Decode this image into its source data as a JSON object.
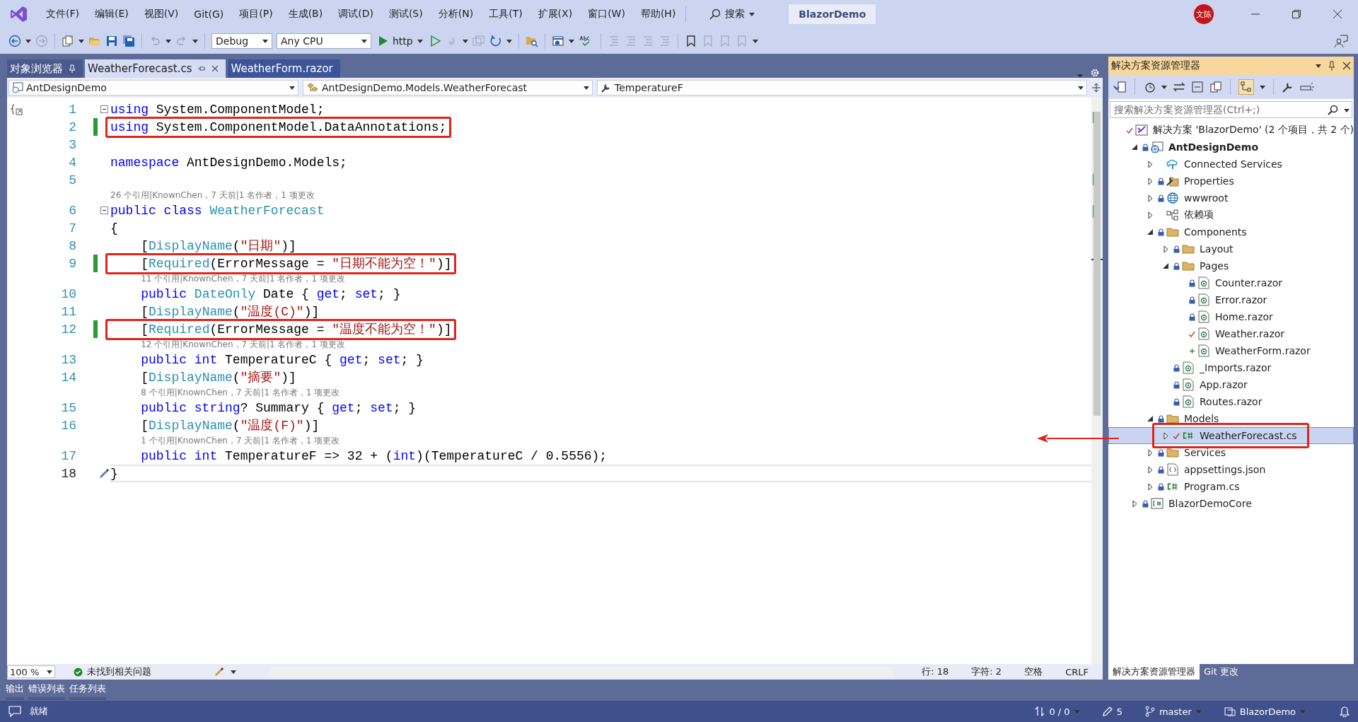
{
  "menu": {
    "items": [
      "文件(F)",
      "编辑(E)",
      "视图(V)",
      "Git(G)",
      "项目(P)",
      "生成(B)",
      "调试(D)",
      "测试(S)",
      "分析(N)",
      "工具(T)",
      "扩展(X)",
      "窗口(W)",
      "帮助(H)"
    ],
    "search": "搜索",
    "title": "BlazorDemo",
    "avatar": "文陈"
  },
  "toolbar": {
    "configuration": "Debug",
    "platform": "Any CPU",
    "run_target": "http"
  },
  "doc_tabs": [
    {
      "label": "对象浏览器",
      "selected": false,
      "pinned": true
    },
    {
      "label": "WeatherForecast.cs",
      "selected": true,
      "pinned": false
    },
    {
      "label": "WeatherForm.razor",
      "selected": false,
      "pinned": false
    }
  ],
  "nav_bar": {
    "project": "AntDesignDemo",
    "type": "AntDesignDemo.Models.WeatherForecast",
    "member": "TemperatureF"
  },
  "editor": {
    "lines": [
      {
        "kind": "code",
        "number": "1",
        "changed": false,
        "boxed": false,
        "fold": true,
        "current": false,
        "tokens": [
          {
            "kind": "keyword",
            "text": "using"
          },
          {
            "kind": "plain",
            "text": " System.ComponentModel;"
          }
        ]
      },
      {
        "kind": "code",
        "number": "2",
        "changed": true,
        "boxed": true,
        "fold": false,
        "current": false,
        "tokens": [
          {
            "kind": "keyword",
            "text": "using"
          },
          {
            "kind": "plain",
            "text": " System.ComponentModel.DataAnnotations;"
          }
        ]
      },
      {
        "kind": "code",
        "number": "3",
        "changed": false,
        "fold": false,
        "current": false
      },
      {
        "kind": "code",
        "number": "4",
        "changed": false,
        "boxed": false,
        "fold": false,
        "current": false,
        "tokens": [
          {
            "kind": "keyword",
            "text": "namespace"
          },
          {
            "kind": "plain",
            "text": " AntDesignDemo.Models;"
          }
        ]
      },
      {
        "kind": "code",
        "number": "5",
        "changed": false,
        "fold": false,
        "current": false
      },
      {
        "kind": "codelens",
        "text": "26 个引用|KnownChen，7 天前|1 名作者，1 项更改"
      },
      {
        "kind": "code",
        "number": "6",
        "changed": false,
        "boxed": false,
        "fold": true,
        "current": false,
        "tokens": [
          {
            "kind": "keyword",
            "text": "public class"
          },
          {
            "kind": "type",
            "text": " WeatherForecast"
          }
        ]
      },
      {
        "kind": "code",
        "number": "7",
        "changed": false,
        "boxed": false,
        "fold": false,
        "current": false,
        "tokens": [
          {
            "kind": "plain",
            "text": "{"
          }
        ]
      },
      {
        "kind": "code",
        "number": "8",
        "changed": false,
        "boxed": false,
        "fold": false,
        "current": false,
        "tokens": [
          {
            "kind": "plain",
            "text": "    ["
          },
          {
            "kind": "type",
            "text": "DisplayName"
          },
          {
            "kind": "plain",
            "text": "("
          },
          {
            "kind": "string",
            "text": "\"日期\""
          },
          {
            "kind": "plain",
            "text": ")]"
          }
        ]
      },
      {
        "kind": "code",
        "number": "9",
        "changed": true,
        "boxed": true,
        "fold": false,
        "current": false,
        "tokens": [
          {
            "kind": "plain",
            "text": "    ["
          },
          {
            "kind": "type",
            "text": "Required"
          },
          {
            "kind": "plain",
            "text": "(ErrorMessage = "
          },
          {
            "kind": "string",
            "text": "\"日期不能为空！\""
          },
          {
            "kind": "plain",
            "text": ")]"
          }
        ]
      },
      {
        "kind": "codelens",
        "text": "11 个引用|KnownChen，7 天前|1 名作者，1 项更改"
      },
      {
        "kind": "code",
        "number": "10",
        "changed": false,
        "boxed": false,
        "fold": false,
        "current": false,
        "tokens": [
          {
            "kind": "keyword",
            "text": "    public"
          },
          {
            "kind": "type",
            "text": " DateOnly"
          },
          {
            "kind": "plain",
            "text": " Date { "
          },
          {
            "kind": "keyword",
            "text": "get"
          },
          {
            "kind": "plain",
            "text": "; "
          },
          {
            "kind": "keyword",
            "text": "set"
          },
          {
            "kind": "plain",
            "text": "; }"
          }
        ]
      },
      {
        "kind": "code",
        "number": "11",
        "changed": false,
        "boxed": false,
        "fold": false,
        "current": false,
        "tokens": [
          {
            "kind": "plain",
            "text": "    ["
          },
          {
            "kind": "type",
            "text": "DisplayName"
          },
          {
            "kind": "plain",
            "text": "("
          },
          {
            "kind": "string",
            "text": "\"温度(C)\""
          },
          {
            "kind": "plain",
            "text": ")]"
          }
        ]
      },
      {
        "kind": "code",
        "number": "12",
        "changed": true,
        "boxed": true,
        "fold": false,
        "current": false,
        "tokens": [
          {
            "kind": "plain",
            "text": "    ["
          },
          {
            "kind": "type",
            "text": "Required"
          },
          {
            "kind": "plain",
            "text": "(ErrorMessage = "
          },
          {
            "kind": "string",
            "text": "\"温度不能为空！\""
          },
          {
            "kind": "plain",
            "text": ")]"
          }
        ]
      },
      {
        "kind": "codelens",
        "text": "12 个引用|KnownChen，7 天前|1 名作者，1 项更改"
      },
      {
        "kind": "code",
        "number": "13",
        "changed": false,
        "boxed": false,
        "fold": false,
        "current": false,
        "tokens": [
          {
            "kind": "keyword",
            "text": "    public int"
          },
          {
            "kind": "plain",
            "text": " TemperatureC { "
          },
          {
            "kind": "keyword",
            "text": "get"
          },
          {
            "kind": "plain",
            "text": "; "
          },
          {
            "kind": "keyword",
            "text": "set"
          },
          {
            "kind": "plain",
            "text": "; }"
          }
        ]
      },
      {
        "kind": "code",
        "number": "14",
        "changed": false,
        "boxed": false,
        "fold": false,
        "current": false,
        "tokens": [
          {
            "kind": "plain",
            "text": "    ["
          },
          {
            "kind": "type",
            "text": "DisplayName"
          },
          {
            "kind": "plain",
            "text": "("
          },
          {
            "kind": "string",
            "text": "\"摘要\""
          },
          {
            "kind": "plain",
            "text": ")]"
          }
        ]
      },
      {
        "kind": "codelens",
        "text": "8 个引用|KnownChen，7 天前|1 名作者，1 项更改"
      },
      {
        "kind": "code",
        "number": "15",
        "changed": false,
        "boxed": false,
        "fold": false,
        "current": false,
        "tokens": [
          {
            "kind": "keyword",
            "text": "    public string"
          },
          {
            "kind": "plain",
            "text": "? Summary { "
          },
          {
            "kind": "keyword",
            "text": "get"
          },
          {
            "kind": "plain",
            "text": "; "
          },
          {
            "kind": "keyword",
            "text": "set"
          },
          {
            "kind": "plain",
            "text": "; }"
          }
        ]
      },
      {
        "kind": "code",
        "number": "16",
        "changed": false,
        "boxed": false,
        "fold": false,
        "current": false,
        "tokens": [
          {
            "kind": "plain",
            "text": "    ["
          },
          {
            "kind": "type",
            "text": "DisplayName"
          },
          {
            "kind": "plain",
            "text": "("
          },
          {
            "kind": "string",
            "text": "\"温度(F)\""
          },
          {
            "kind": "plain",
            "text": ")]"
          }
        ]
      },
      {
        "kind": "codelens",
        "text": "1 个引用|KnownChen，7 天前|1 名作者，1 项更改"
      },
      {
        "kind": "code",
        "number": "17",
        "changed": false,
        "boxed": false,
        "fold": false,
        "current": false,
        "tokens": [
          {
            "kind": "keyword",
            "text": "    public int"
          },
          {
            "kind": "plain",
            "text": " TemperatureF => 32 + ("
          },
          {
            "kind": "keyword",
            "text": "int"
          },
          {
            "kind": "plain",
            "text": ")(TemperatureC / 0.5556);"
          }
        ]
      },
      {
        "kind": "code",
        "number": "18",
        "changed": false,
        "boxed": false,
        "fold": false,
        "current": true,
        "tokens": [
          {
            "kind": "plain",
            "text": "}"
          }
        ]
      }
    ]
  },
  "editor_status": {
    "zoom": "100 %",
    "issues": "未找到相关问题",
    "line": "行: 18",
    "column": "字符: 2",
    "whitespace": "空格",
    "line_ending": "CRLF"
  },
  "solution_explorer": {
    "title": "解决方案资源管理器",
    "search": {
      "placeholder": "搜索解决方案资源管理器(Ctrl+;)"
    },
    "tree": [
      {
        "label": "解决方案 'BlazorDemo' (2 个项目，共 2 个)",
        "kind": "solution",
        "locked": false,
        "modified": true,
        "added": false,
        "selected": false,
        "children": [
          {
            "label": "AntDesignDemo",
            "kind": "web-project",
            "locked": true,
            "modified": false,
            "added": false,
            "selected": false,
            "expanded": true,
            "children": [
              {
                "label": "Connected Services",
                "kind": "services",
                "locked": false,
                "modified": false,
                "added": false,
                "selected": false,
                "expanded": false
              },
              {
                "label": "Properties",
                "kind": "properties",
                "locked": true,
                "modified": false,
                "added": false,
                "selected": false,
                "expanded": false
              },
              {
                "label": "wwwroot",
                "kind": "web",
                "locked": true,
                "modified": false,
                "added": false,
                "selected": false,
                "expanded": false
              },
              {
                "label": "依赖项",
                "kind": "dependencies",
                "locked": false,
                "modified": false,
                "added": false,
                "selected": false,
                "expanded": false
              },
              {
                "label": "Components",
                "kind": "folder",
                "locked": true,
                "modified": false,
                "added": false,
                "selected": false,
                "expanded": true,
                "children": [
                  {
                    "label": "Layout",
                    "kind": "folder",
                    "locked": true,
                    "modified": false,
                    "added": false,
                    "selected": false,
                    "expanded": false
                  },
                  {
                    "label": "Pages",
                    "kind": "folder",
                    "locked": true,
                    "modified": false,
                    "added": false,
                    "selected": false,
                    "expanded": true,
                    "children": [
                      {
                        "label": "Counter.razor",
                        "kind": "razor",
                        "locked": true,
                        "modified": false,
                        "added": false,
                        "selected": false
                      },
                      {
                        "label": "Error.razor",
                        "kind": "razor",
                        "locked": true,
                        "modified": false,
                        "added": false,
                        "selected": false
                      },
                      {
                        "label": "Home.razor",
                        "kind": "razor",
                        "locked": true,
                        "modified": false,
                        "added": false,
                        "selected": false
                      },
                      {
                        "label": "Weather.razor",
                        "kind": "razor",
                        "locked": false,
                        "modified": true,
                        "added": false,
                        "selected": false
                      },
                      {
                        "label": "WeatherForm.razor",
                        "kind": "razor",
                        "locked": false,
                        "modified": false,
                        "added": true,
                        "selected": false
                      }
                    ]
                  },
                  {
                    "label": "_Imports.razor",
                    "kind": "razor",
                    "locked": true,
                    "modified": false,
                    "added": false,
                    "selected": false
                  },
                  {
                    "label": "App.razor",
                    "kind": "razor",
                    "locked": true,
                    "modified": false,
                    "added": false,
                    "selected": false
                  },
                  {
                    "label": "Routes.razor",
                    "kind": "razor",
                    "locked": true,
                    "modified": false,
                    "added": false,
                    "selected": false
                  }
                ]
              },
              {
                "label": "Models",
                "kind": "folder",
                "locked": true,
                "modified": false,
                "added": false,
                "selected": false,
                "expanded": true,
                "children": [
                  {
                    "label": "WeatherForecast.cs",
                    "kind": "csharp",
                    "locked": false,
                    "modified": true,
                    "added": false,
                    "selected": true,
                    "expanded": false,
                    "boxed": true
                  }
                ]
              },
              {
                "label": "Services",
                "kind": "folder",
                "locked": true,
                "modified": false,
                "added": false,
                "selected": false,
                "expanded": false
              },
              {
                "label": "appsettings.json",
                "kind": "json",
                "locked": true,
                "modified": false,
                "added": false,
                "selected": false,
                "expanded": false
              },
              {
                "label": "Program.cs",
                "kind": "csharp",
                "locked": true,
                "modified": false,
                "added": false,
                "selected": false,
                "expanded": false
              }
            ]
          },
          {
            "label": "BlazorDemoCore",
            "kind": "cs-project",
            "locked": true,
            "modified": false,
            "added": false,
            "selected": false,
            "expanded": false
          }
        ]
      }
    ],
    "tabs": [
      {
        "label": "解决方案资源管理器",
        "selected": true
      },
      {
        "label": "Git 更改",
        "selected": false
      }
    ]
  },
  "tool_tabs": [
    "输出",
    "错误列表",
    "任务列表"
  ],
  "status_bar": {
    "message": "就绪",
    "errors": "0 / 0",
    "changes": "5",
    "branch": "master",
    "repository": "BlazorDemo"
  }
}
